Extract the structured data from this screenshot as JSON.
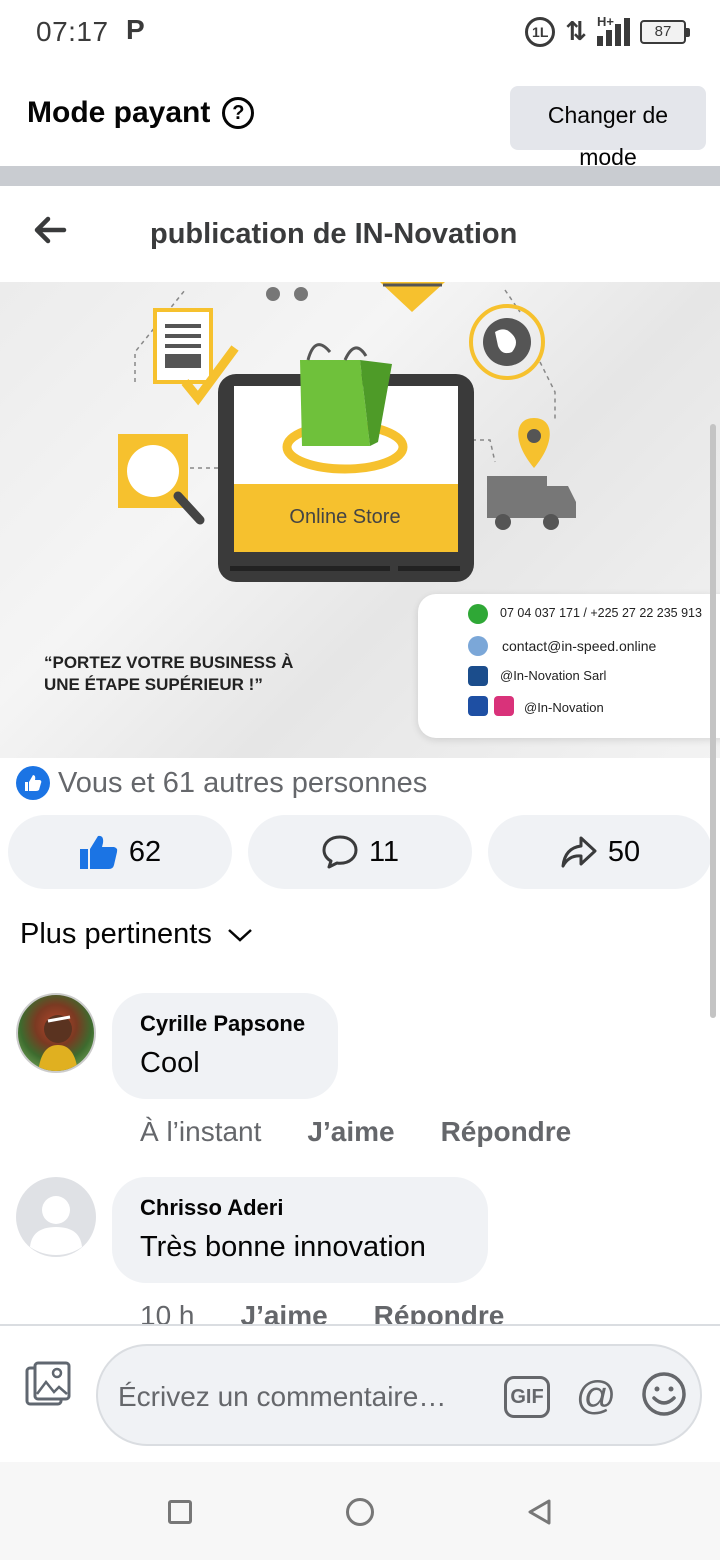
{
  "status_bar": {
    "time": "07:17",
    "carrier_icon": "P",
    "battery": "87",
    "network": "H+"
  },
  "mode_bar": {
    "title": "Mode payant",
    "change_button": "Changer de mode"
  },
  "header": {
    "title": "publication de IN-Novation"
  },
  "post_image": {
    "label": "Online Store",
    "quote": "“PORTEZ VOTRE BUSINESS À UNE ÉTAPE SUPÉRIEUR !”",
    "contact_phone": "07 04 037 171 / +225 27 22 235 913",
    "contact_email": "contact@in-speed.online",
    "contact_linkedin": "@In-Novation Sarl",
    "contact_social": "@In-Novation"
  },
  "reactions": {
    "summary": "Vous et 61 autres personnes"
  },
  "actions": {
    "likes": "62",
    "comments": "11",
    "shares": "50"
  },
  "sort": {
    "label": "Plus pertinents"
  },
  "comments": [
    {
      "author": "Cyrille Papsone",
      "text": "Cool",
      "time": "À l’instant",
      "like": "J’aime",
      "reply": "Répondre"
    },
    {
      "author": "Chrisso Aderi",
      "text": "Très bonne innovation",
      "time": "10 h",
      "like": "J’aime",
      "reply": "Répondre"
    }
  ],
  "comment_input": {
    "placeholder": "Écrivez un commentaire…",
    "gif": "GIF",
    "at": "@"
  },
  "colors": {
    "accent": "#1b74e4",
    "bubble": "#f0f2f5",
    "secondary_text": "#65676b",
    "yellow": "#f6c12e",
    "green": "#6fc13b"
  }
}
